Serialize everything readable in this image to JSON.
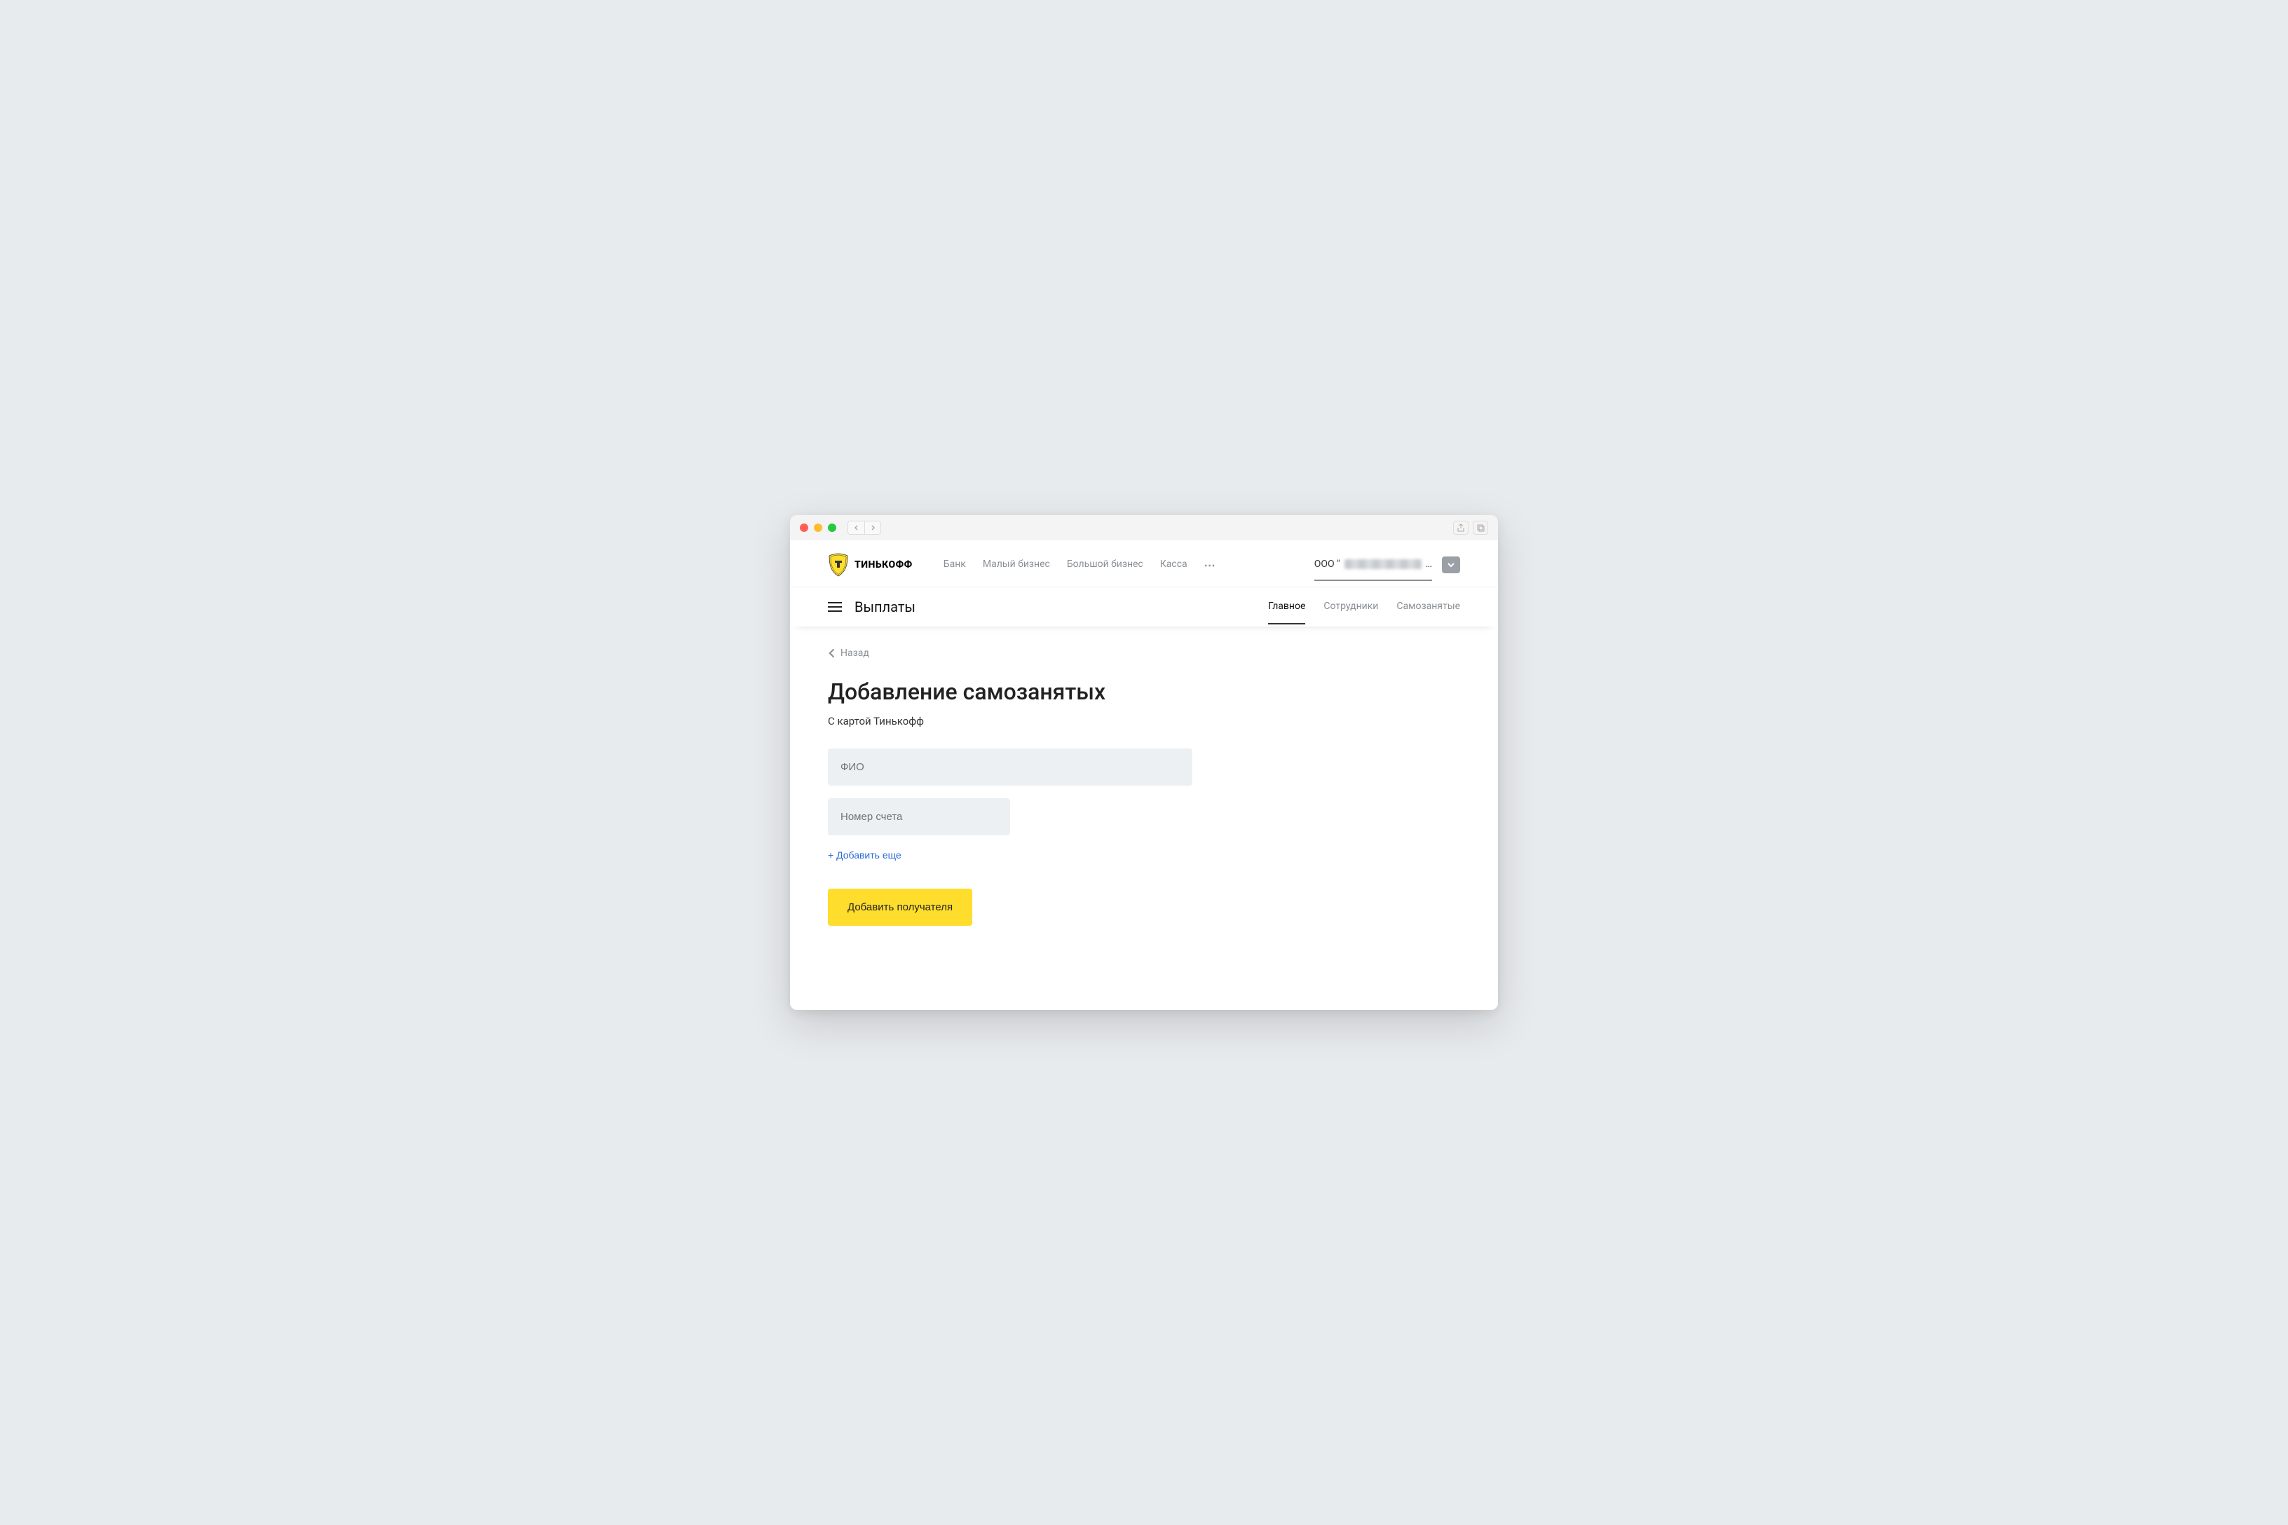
{
  "brand": {
    "name": "ТИНЬКОФФ"
  },
  "main_nav": {
    "items": [
      "Банк",
      "Малый бизнес",
      "Большой бизнес",
      "Касса"
    ],
    "more_icon": "⋯"
  },
  "company": {
    "prefix": "ООО \"",
    "suffix": "…"
  },
  "sub": {
    "title": "Выплаты",
    "tabs": [
      "Главное",
      "Сотрудники",
      "Самозанятые"
    ],
    "active_index": 0
  },
  "back": {
    "label": "Назад"
  },
  "page": {
    "heading": "Добавление самозанятых",
    "subtitle": "С картой Тинькофф"
  },
  "form": {
    "fio_placeholder": "ФИО",
    "account_placeholder": "Номер счета",
    "add_more_label": "+ Добавить еще",
    "submit_label": "Добавить получателя"
  },
  "colors": {
    "accent": "#ffdd2d",
    "link": "#2a6dd6"
  }
}
